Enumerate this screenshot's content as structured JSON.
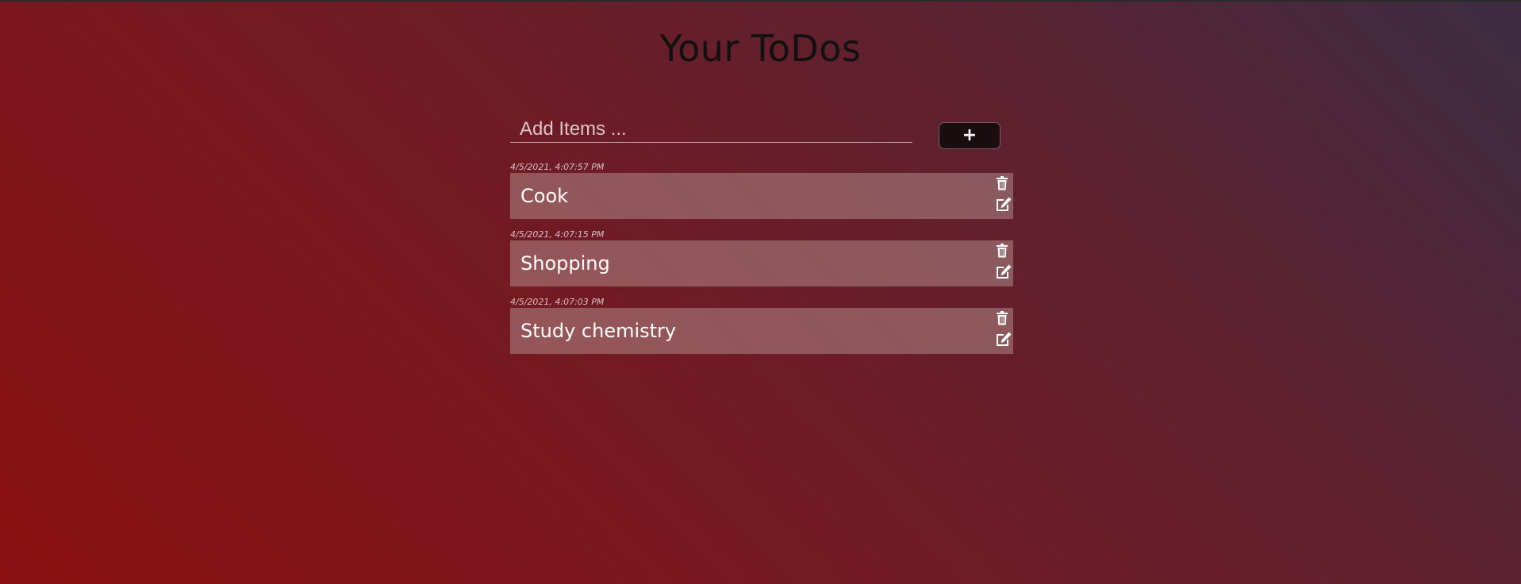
{
  "header": {
    "title": "Your ToDos"
  },
  "add_form": {
    "placeholder": "Add Items ...",
    "value": "",
    "add_button_label": "+"
  },
  "todos": [
    {
      "timestamp": "4/5/2021, 4:07:57 PM",
      "text": "Cook"
    },
    {
      "timestamp": "4/5/2021, 4:07:15 PM",
      "text": "Shopping"
    },
    {
      "timestamp": "4/5/2021, 4:07:03 PM",
      "text": "Study chemistry"
    }
  ],
  "icons": {
    "delete": "trash-icon",
    "edit": "edit-icon"
  },
  "colors": {
    "gradient_start": "#8a1013",
    "gradient_end": "#3d2d42",
    "card": "#a07876",
    "button": "#1b0e10"
  }
}
